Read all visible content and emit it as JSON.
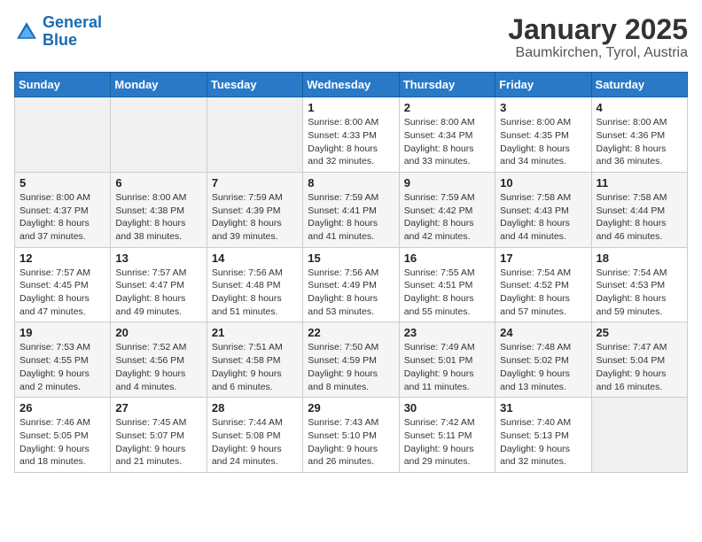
{
  "header": {
    "logo_line1": "General",
    "logo_line2": "Blue",
    "title": "January 2025",
    "subtitle": "Baumkirchen, Tyrol, Austria"
  },
  "weekdays": [
    "Sunday",
    "Monday",
    "Tuesday",
    "Wednesday",
    "Thursday",
    "Friday",
    "Saturday"
  ],
  "weeks": [
    [
      {
        "day": "",
        "info": ""
      },
      {
        "day": "",
        "info": ""
      },
      {
        "day": "",
        "info": ""
      },
      {
        "day": "1",
        "info": "Sunrise: 8:00 AM\nSunset: 4:33 PM\nDaylight: 8 hours\nand 32 minutes."
      },
      {
        "day": "2",
        "info": "Sunrise: 8:00 AM\nSunset: 4:34 PM\nDaylight: 8 hours\nand 33 minutes."
      },
      {
        "day": "3",
        "info": "Sunrise: 8:00 AM\nSunset: 4:35 PM\nDaylight: 8 hours\nand 34 minutes."
      },
      {
        "day": "4",
        "info": "Sunrise: 8:00 AM\nSunset: 4:36 PM\nDaylight: 8 hours\nand 36 minutes."
      }
    ],
    [
      {
        "day": "5",
        "info": "Sunrise: 8:00 AM\nSunset: 4:37 PM\nDaylight: 8 hours\nand 37 minutes."
      },
      {
        "day": "6",
        "info": "Sunrise: 8:00 AM\nSunset: 4:38 PM\nDaylight: 8 hours\nand 38 minutes."
      },
      {
        "day": "7",
        "info": "Sunrise: 7:59 AM\nSunset: 4:39 PM\nDaylight: 8 hours\nand 39 minutes."
      },
      {
        "day": "8",
        "info": "Sunrise: 7:59 AM\nSunset: 4:41 PM\nDaylight: 8 hours\nand 41 minutes."
      },
      {
        "day": "9",
        "info": "Sunrise: 7:59 AM\nSunset: 4:42 PM\nDaylight: 8 hours\nand 42 minutes."
      },
      {
        "day": "10",
        "info": "Sunrise: 7:58 AM\nSunset: 4:43 PM\nDaylight: 8 hours\nand 44 minutes."
      },
      {
        "day": "11",
        "info": "Sunrise: 7:58 AM\nSunset: 4:44 PM\nDaylight: 8 hours\nand 46 minutes."
      }
    ],
    [
      {
        "day": "12",
        "info": "Sunrise: 7:57 AM\nSunset: 4:45 PM\nDaylight: 8 hours\nand 47 minutes."
      },
      {
        "day": "13",
        "info": "Sunrise: 7:57 AM\nSunset: 4:47 PM\nDaylight: 8 hours\nand 49 minutes."
      },
      {
        "day": "14",
        "info": "Sunrise: 7:56 AM\nSunset: 4:48 PM\nDaylight: 8 hours\nand 51 minutes."
      },
      {
        "day": "15",
        "info": "Sunrise: 7:56 AM\nSunset: 4:49 PM\nDaylight: 8 hours\nand 53 minutes."
      },
      {
        "day": "16",
        "info": "Sunrise: 7:55 AM\nSunset: 4:51 PM\nDaylight: 8 hours\nand 55 minutes."
      },
      {
        "day": "17",
        "info": "Sunrise: 7:54 AM\nSunset: 4:52 PM\nDaylight: 8 hours\nand 57 minutes."
      },
      {
        "day": "18",
        "info": "Sunrise: 7:54 AM\nSunset: 4:53 PM\nDaylight: 8 hours\nand 59 minutes."
      }
    ],
    [
      {
        "day": "19",
        "info": "Sunrise: 7:53 AM\nSunset: 4:55 PM\nDaylight: 9 hours\nand 2 minutes."
      },
      {
        "day": "20",
        "info": "Sunrise: 7:52 AM\nSunset: 4:56 PM\nDaylight: 9 hours\nand 4 minutes."
      },
      {
        "day": "21",
        "info": "Sunrise: 7:51 AM\nSunset: 4:58 PM\nDaylight: 9 hours\nand 6 minutes."
      },
      {
        "day": "22",
        "info": "Sunrise: 7:50 AM\nSunset: 4:59 PM\nDaylight: 9 hours\nand 8 minutes."
      },
      {
        "day": "23",
        "info": "Sunrise: 7:49 AM\nSunset: 5:01 PM\nDaylight: 9 hours\nand 11 minutes."
      },
      {
        "day": "24",
        "info": "Sunrise: 7:48 AM\nSunset: 5:02 PM\nDaylight: 9 hours\nand 13 minutes."
      },
      {
        "day": "25",
        "info": "Sunrise: 7:47 AM\nSunset: 5:04 PM\nDaylight: 9 hours\nand 16 minutes."
      }
    ],
    [
      {
        "day": "26",
        "info": "Sunrise: 7:46 AM\nSunset: 5:05 PM\nDaylight: 9 hours\nand 18 minutes."
      },
      {
        "day": "27",
        "info": "Sunrise: 7:45 AM\nSunset: 5:07 PM\nDaylight: 9 hours\nand 21 minutes."
      },
      {
        "day": "28",
        "info": "Sunrise: 7:44 AM\nSunset: 5:08 PM\nDaylight: 9 hours\nand 24 minutes."
      },
      {
        "day": "29",
        "info": "Sunrise: 7:43 AM\nSunset: 5:10 PM\nDaylight: 9 hours\nand 26 minutes."
      },
      {
        "day": "30",
        "info": "Sunrise: 7:42 AM\nSunset: 5:11 PM\nDaylight: 9 hours\nand 29 minutes."
      },
      {
        "day": "31",
        "info": "Sunrise: 7:40 AM\nSunset: 5:13 PM\nDaylight: 9 hours\nand 32 minutes."
      },
      {
        "day": "",
        "info": ""
      }
    ]
  ]
}
